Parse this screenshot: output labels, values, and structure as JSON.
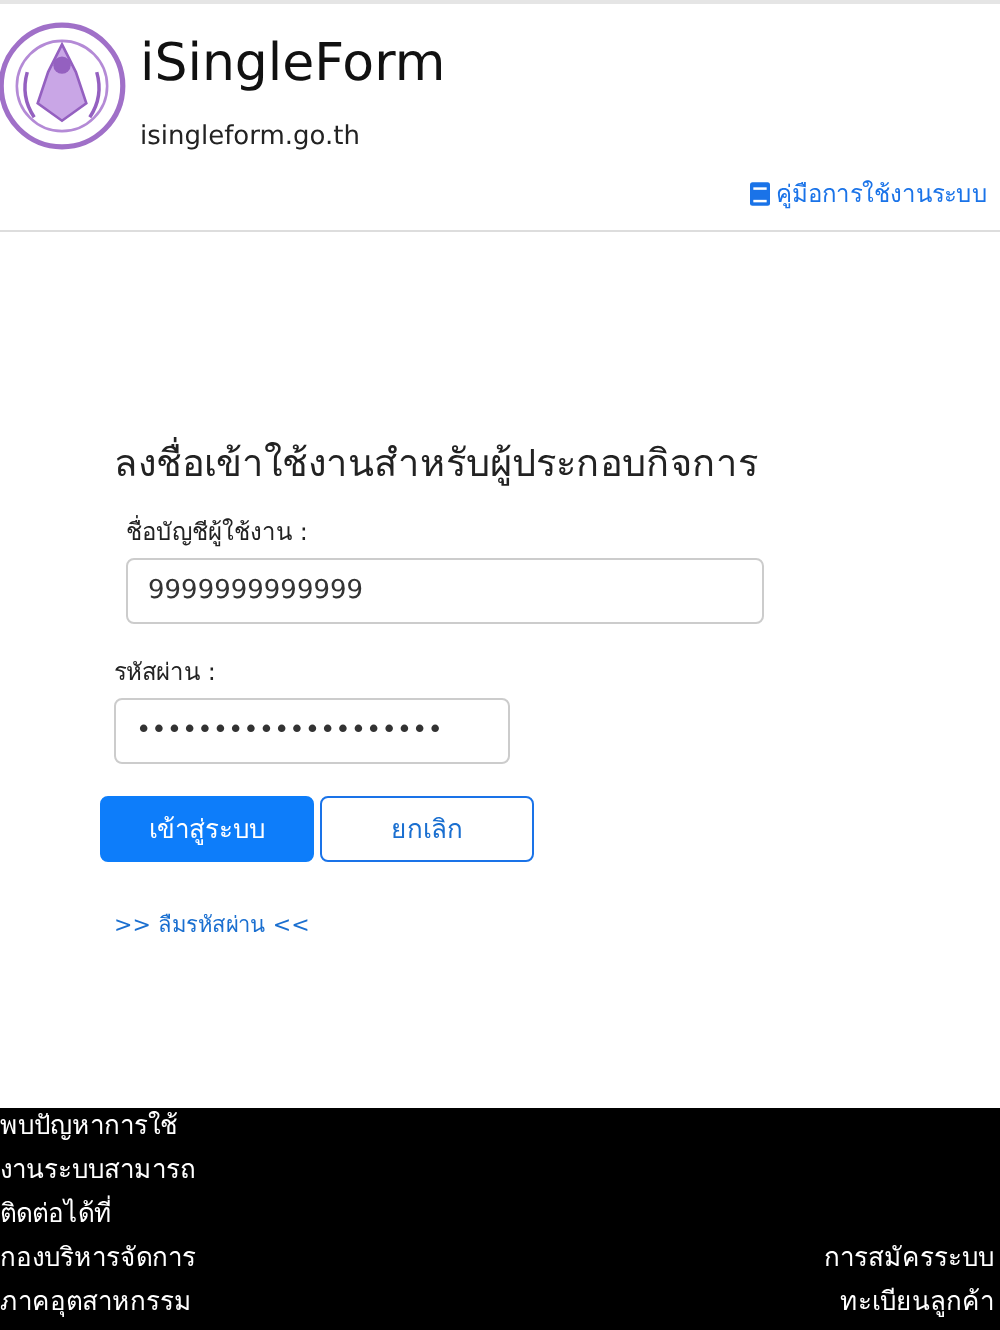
{
  "header": {
    "title": "iSingleForm",
    "subtitle": "isingleform.go.th",
    "manual_link": "คู่มือการใช้งานระบบ"
  },
  "login": {
    "heading": "ลงชื่อเข้าใช้งานสำหรับผู้ประกอบกิจการ",
    "fields": [
      {
        "label": "ชื่อบัญชีผู้ใช้งาน :",
        "value": "9999999999999",
        "kind": "text"
      },
      {
        "label": "รหัสผ่าน :",
        "value": "••••••••••••••••••••",
        "kind": "password"
      }
    ],
    "buttons": [
      {
        "label": "เข้าสู่ระบบ",
        "kind": "primary"
      },
      {
        "label": "ยกเลิก",
        "kind": "secondary"
      }
    ],
    "forgot_link": ">> ลืมรหัสผ่าน <<"
  },
  "footer": {
    "contact_lines": [
      "พบปัญหาการใช้",
      "งานระบบสามารถ",
      "ติดต่อได้ที่",
      "กองบริหารจัดการ",
      "ภาคอุตสาหกรรม"
    ],
    "register_lines": [
      "การสมัครระบบ",
      "ทะเบียนลูกค้า"
    ]
  }
}
